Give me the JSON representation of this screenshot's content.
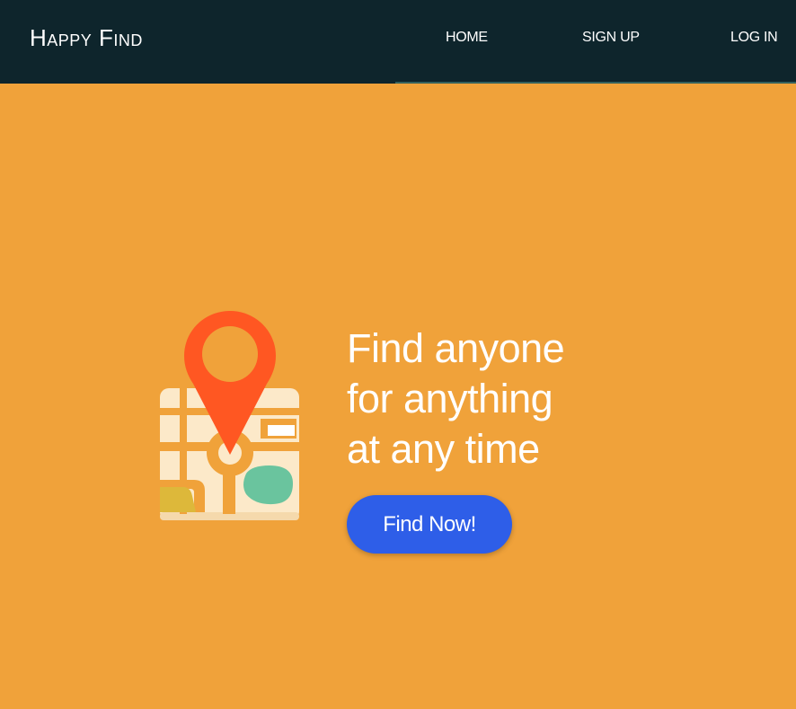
{
  "nav": {
    "brand": "Happy Find",
    "links": [
      {
        "label": "HOME"
      },
      {
        "label": "SIGN UP"
      },
      {
        "label": "LOG IN"
      }
    ]
  },
  "hero": {
    "headline_lines": [
      "Find anyone",
      "for anything",
      "at any time"
    ],
    "cta_label": "Find Now!",
    "illustration_icon": "map-pin-icon"
  },
  "colors": {
    "navbar_bg": "#0E252C",
    "hero_bg": "#F0A23A",
    "cta_bg": "#2E5EE8",
    "pin": "#FF5722",
    "map_base": "#FCE9C9"
  }
}
